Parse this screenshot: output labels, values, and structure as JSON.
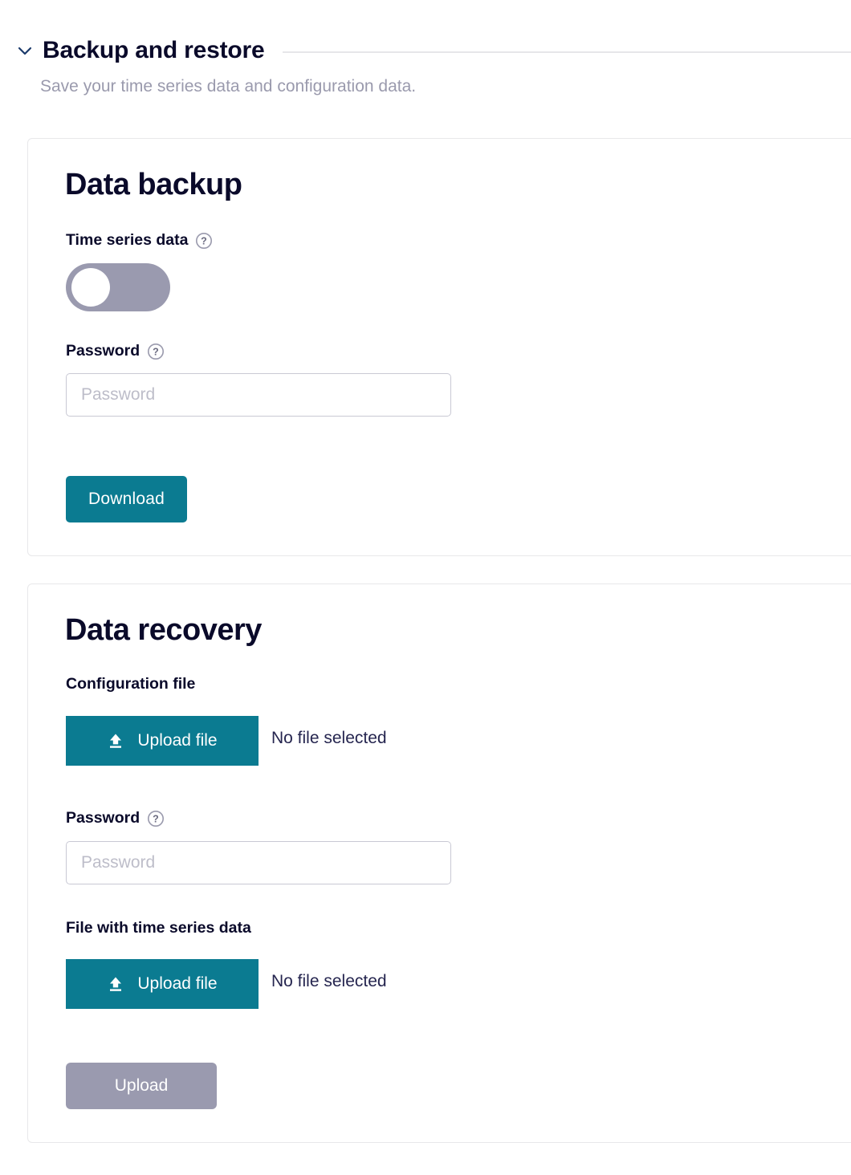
{
  "section": {
    "title": "Backup and restore",
    "subtitle": "Save your time series data and configuration data.",
    "collapse_icon": "chevron-down-icon",
    "expanded": true
  },
  "backup_card": {
    "title": "Data backup",
    "time_series": {
      "label": "Time series data",
      "help_icon": "question-circle-icon",
      "toggle_state": "off"
    },
    "password": {
      "label": "Password",
      "help_icon": "question-circle-icon",
      "value": "",
      "placeholder": "Password"
    },
    "download_button": {
      "label": "Download",
      "enabled": true
    }
  },
  "recovery_card": {
    "title": "Data recovery",
    "configuration_file": {
      "label": "Configuration file",
      "upload_button_label": "Upload file",
      "upload_icon": "upload-arrow-icon",
      "status": "No file selected"
    },
    "password": {
      "label": "Password",
      "help_icon": "question-circle-icon",
      "value": "",
      "placeholder": "Password"
    },
    "time_series_file": {
      "label": "File with time series data",
      "upload_button_label": "Upload file",
      "upload_icon": "upload-arrow-icon",
      "status": "No file selected"
    },
    "upload_button": {
      "label": "Upload",
      "enabled": false
    }
  },
  "colors": {
    "accent_teal": "#0b7b91",
    "heading_navy": "#0a0a2a",
    "muted_gray": "#9a9aad",
    "disabled_gray": "#9a9aaf",
    "border_gray": "#e8e8ea",
    "input_border": "#c9c9d4"
  }
}
